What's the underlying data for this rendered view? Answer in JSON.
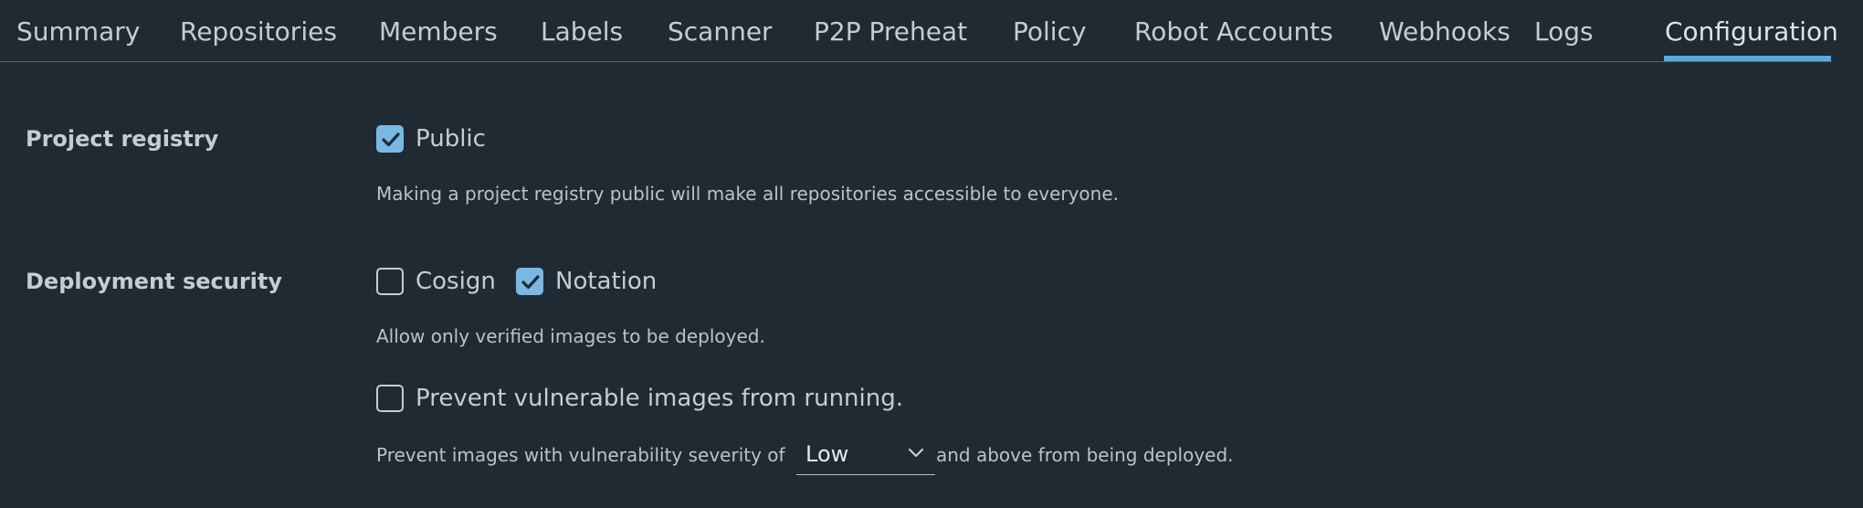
{
  "tabs": [
    {
      "label": "Summary",
      "active": false
    },
    {
      "label": "Repositories",
      "active": false
    },
    {
      "label": "Members",
      "active": false
    },
    {
      "label": "Labels",
      "active": false
    },
    {
      "label": "Scanner",
      "active": false
    },
    {
      "label": "P2P Preheat",
      "active": false
    },
    {
      "label": "Policy",
      "active": false
    },
    {
      "label": "Robot Accounts",
      "active": false
    },
    {
      "label": "Webhooks",
      "active": false
    },
    {
      "label": "Logs",
      "active": false
    },
    {
      "label": "Configuration",
      "active": true
    }
  ],
  "project_registry": {
    "label": "Project registry",
    "public_option": {
      "label": "Public",
      "checked": true
    },
    "helper": "Making a project registry public will make all repositories accessible to everyone."
  },
  "deployment_security": {
    "label": "Deployment security",
    "cosign": {
      "label": "Cosign",
      "checked": false
    },
    "notation": {
      "label": "Notation",
      "checked": true
    },
    "helper": "Allow only verified images to be deployed.",
    "prevent_vulnerable": {
      "label": "Prevent vulnerable images from running.",
      "checked": false
    },
    "severity_prefix": "Prevent images with vulnerability severity of",
    "severity_value": "Low",
    "severity_suffix": "and above from being deployed."
  },
  "colors": {
    "background": "#1f2a33",
    "accent": "#5aa9dc",
    "checkbox_checked": "#79b8e3",
    "text": "#c3cdd4"
  },
  "icons": {
    "checkmark": "check-icon",
    "dropdown": "chevron-down-icon"
  }
}
